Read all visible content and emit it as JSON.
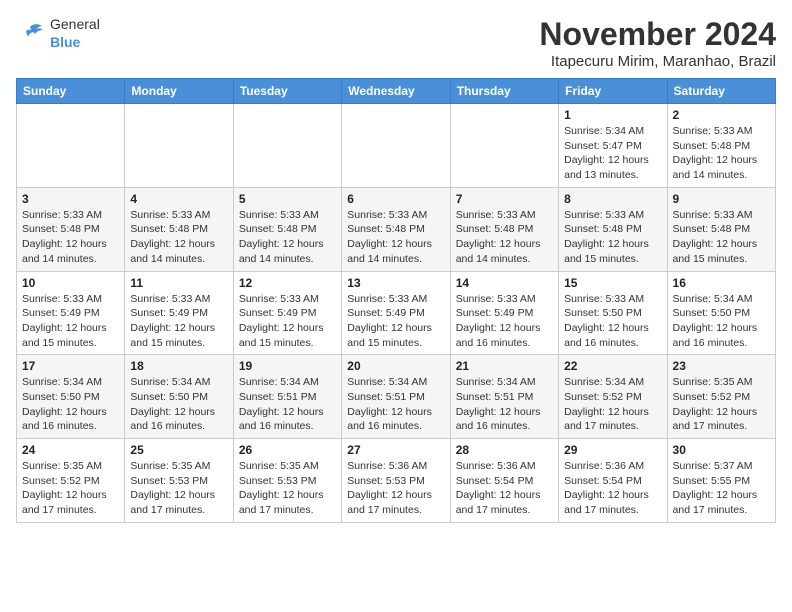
{
  "logo": {
    "general": "General",
    "blue": "Blue"
  },
  "header": {
    "title": "November 2024",
    "subtitle": "Itapecuru Mirim, Maranhao, Brazil"
  },
  "weekdays": [
    "Sunday",
    "Monday",
    "Tuesday",
    "Wednesday",
    "Thursday",
    "Friday",
    "Saturday"
  ],
  "weeks": [
    [
      {
        "day": "",
        "detail": ""
      },
      {
        "day": "",
        "detail": ""
      },
      {
        "day": "",
        "detail": ""
      },
      {
        "day": "",
        "detail": ""
      },
      {
        "day": "",
        "detail": ""
      },
      {
        "day": "1",
        "detail": "Sunrise: 5:34 AM\nSunset: 5:47 PM\nDaylight: 12 hours\nand 13 minutes."
      },
      {
        "day": "2",
        "detail": "Sunrise: 5:33 AM\nSunset: 5:48 PM\nDaylight: 12 hours\nand 14 minutes."
      }
    ],
    [
      {
        "day": "3",
        "detail": "Sunrise: 5:33 AM\nSunset: 5:48 PM\nDaylight: 12 hours\nand 14 minutes."
      },
      {
        "day": "4",
        "detail": "Sunrise: 5:33 AM\nSunset: 5:48 PM\nDaylight: 12 hours\nand 14 minutes."
      },
      {
        "day": "5",
        "detail": "Sunrise: 5:33 AM\nSunset: 5:48 PM\nDaylight: 12 hours\nand 14 minutes."
      },
      {
        "day": "6",
        "detail": "Sunrise: 5:33 AM\nSunset: 5:48 PM\nDaylight: 12 hours\nand 14 minutes."
      },
      {
        "day": "7",
        "detail": "Sunrise: 5:33 AM\nSunset: 5:48 PM\nDaylight: 12 hours\nand 14 minutes."
      },
      {
        "day": "8",
        "detail": "Sunrise: 5:33 AM\nSunset: 5:48 PM\nDaylight: 12 hours\nand 15 minutes."
      },
      {
        "day": "9",
        "detail": "Sunrise: 5:33 AM\nSunset: 5:48 PM\nDaylight: 12 hours\nand 15 minutes."
      }
    ],
    [
      {
        "day": "10",
        "detail": "Sunrise: 5:33 AM\nSunset: 5:49 PM\nDaylight: 12 hours\nand 15 minutes."
      },
      {
        "day": "11",
        "detail": "Sunrise: 5:33 AM\nSunset: 5:49 PM\nDaylight: 12 hours\nand 15 minutes."
      },
      {
        "day": "12",
        "detail": "Sunrise: 5:33 AM\nSunset: 5:49 PM\nDaylight: 12 hours\nand 15 minutes."
      },
      {
        "day": "13",
        "detail": "Sunrise: 5:33 AM\nSunset: 5:49 PM\nDaylight: 12 hours\nand 15 minutes."
      },
      {
        "day": "14",
        "detail": "Sunrise: 5:33 AM\nSunset: 5:49 PM\nDaylight: 12 hours\nand 16 minutes."
      },
      {
        "day": "15",
        "detail": "Sunrise: 5:33 AM\nSunset: 5:50 PM\nDaylight: 12 hours\nand 16 minutes."
      },
      {
        "day": "16",
        "detail": "Sunrise: 5:34 AM\nSunset: 5:50 PM\nDaylight: 12 hours\nand 16 minutes."
      }
    ],
    [
      {
        "day": "17",
        "detail": "Sunrise: 5:34 AM\nSunset: 5:50 PM\nDaylight: 12 hours\nand 16 minutes."
      },
      {
        "day": "18",
        "detail": "Sunrise: 5:34 AM\nSunset: 5:50 PM\nDaylight: 12 hours\nand 16 minutes."
      },
      {
        "day": "19",
        "detail": "Sunrise: 5:34 AM\nSunset: 5:51 PM\nDaylight: 12 hours\nand 16 minutes."
      },
      {
        "day": "20",
        "detail": "Sunrise: 5:34 AM\nSunset: 5:51 PM\nDaylight: 12 hours\nand 16 minutes."
      },
      {
        "day": "21",
        "detail": "Sunrise: 5:34 AM\nSunset: 5:51 PM\nDaylight: 12 hours\nand 16 minutes."
      },
      {
        "day": "22",
        "detail": "Sunrise: 5:34 AM\nSunset: 5:52 PM\nDaylight: 12 hours\nand 17 minutes."
      },
      {
        "day": "23",
        "detail": "Sunrise: 5:35 AM\nSunset: 5:52 PM\nDaylight: 12 hours\nand 17 minutes."
      }
    ],
    [
      {
        "day": "24",
        "detail": "Sunrise: 5:35 AM\nSunset: 5:52 PM\nDaylight: 12 hours\nand 17 minutes."
      },
      {
        "day": "25",
        "detail": "Sunrise: 5:35 AM\nSunset: 5:53 PM\nDaylight: 12 hours\nand 17 minutes."
      },
      {
        "day": "26",
        "detail": "Sunrise: 5:35 AM\nSunset: 5:53 PM\nDaylight: 12 hours\nand 17 minutes."
      },
      {
        "day": "27",
        "detail": "Sunrise: 5:36 AM\nSunset: 5:53 PM\nDaylight: 12 hours\nand 17 minutes."
      },
      {
        "day": "28",
        "detail": "Sunrise: 5:36 AM\nSunset: 5:54 PM\nDaylight: 12 hours\nand 17 minutes."
      },
      {
        "day": "29",
        "detail": "Sunrise: 5:36 AM\nSunset: 5:54 PM\nDaylight: 12 hours\nand 17 minutes."
      },
      {
        "day": "30",
        "detail": "Sunrise: 5:37 AM\nSunset: 5:55 PM\nDaylight: 12 hours\nand 17 minutes."
      }
    ]
  ]
}
